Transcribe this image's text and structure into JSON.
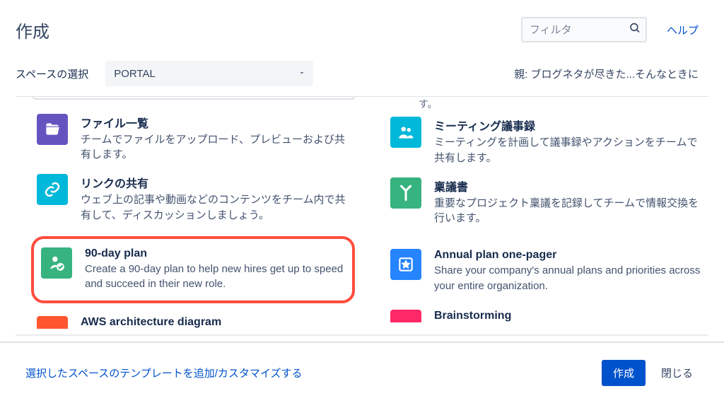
{
  "header": {
    "title": "作成",
    "filter_placeholder": "フィルタ",
    "help": "ヘルプ"
  },
  "subheader": {
    "space_label": "スペースの選択",
    "space_value": "PORTAL",
    "parent_label": "親: ブログネタが尽きた...そんなときに"
  },
  "trail_text": "す。",
  "templates": {
    "left": [
      {
        "title": "ファイル一覧",
        "desc": "チームでファイルをアップロード、プレビューおよび共有します。",
        "icon": "folder-open-icon",
        "color": "#6554c0"
      },
      {
        "title": "リンクの共有",
        "desc": "ウェブ上の記事や動画などのコンテンツをチーム内で共有して、ディスカッションしましょう。",
        "icon": "link-icon",
        "color": "#00b8d9"
      },
      {
        "title": "90-day plan",
        "desc": "Create a 90-day plan to help new hires get up to speed and succeed in their new role.",
        "icon": "person-check-icon",
        "color": "#36b37e"
      },
      {
        "title": "AWS architecture diagram",
        "desc": "",
        "icon": "diagram-icon",
        "color": "#ff5630"
      }
    ],
    "right": [
      {
        "title": "ミーティング議事録",
        "desc": "ミーティングを計画して議事録やアクションをチームで共有します。",
        "icon": "people-icon",
        "color": "#00b8d9"
      },
      {
        "title": "稟議書",
        "desc": "重要なプロジェクト稟議を記録してチームで情報交換を行います。",
        "icon": "branch-icon",
        "color": "#36b37e"
      },
      {
        "title": "Annual plan one-pager",
        "desc": "Share your company's annual plans and priorities across your entire organization.",
        "icon": "star-note-icon",
        "color": "#2684ff"
      },
      {
        "title": "Brainstorming",
        "desc": "",
        "icon": "brainstorm-icon",
        "color": "#ff2866"
      }
    ]
  },
  "footer": {
    "link": "選択したスペースのテンプレートを追加/カスタマイズする",
    "create": "作成",
    "close": "閉じる"
  }
}
